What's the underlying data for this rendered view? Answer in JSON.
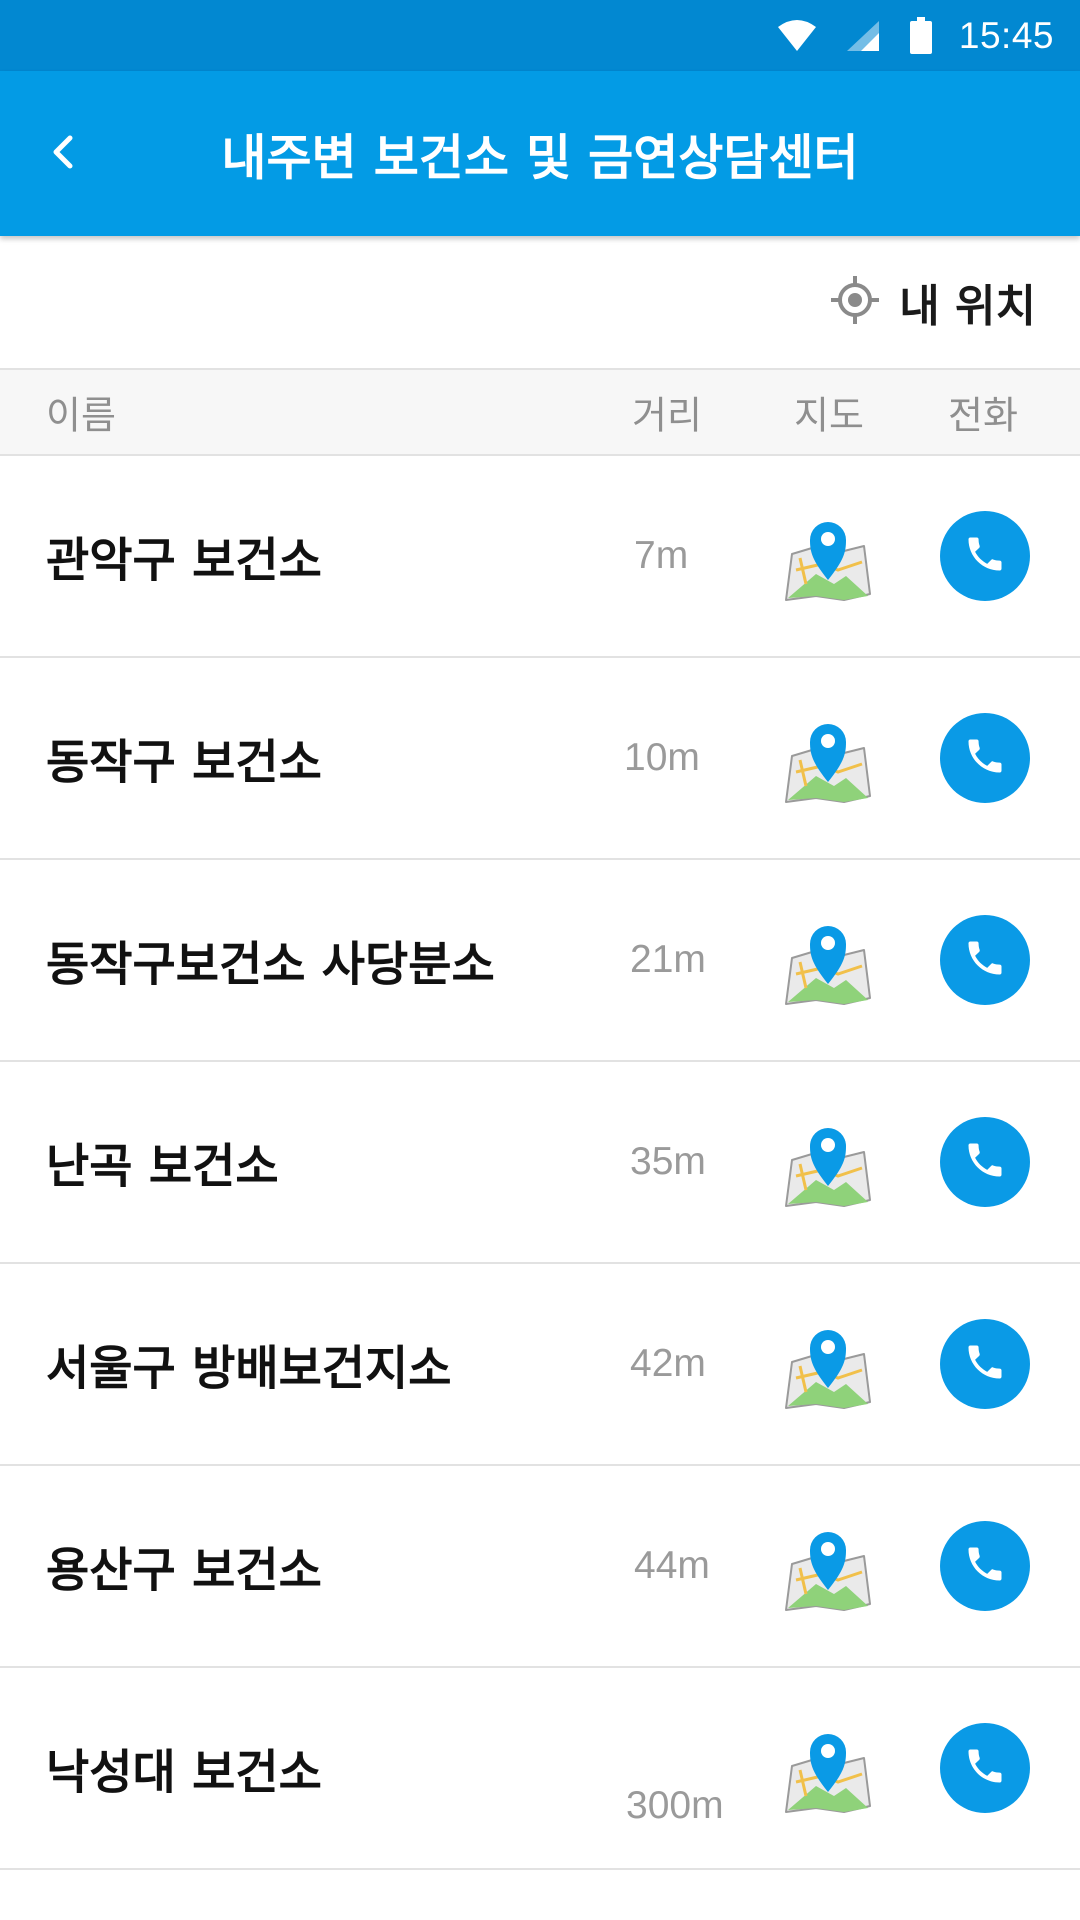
{
  "status_bar": {
    "time": "15:45",
    "icons": [
      "wifi-icon",
      "cell-signal-icon",
      "battery-icon"
    ]
  },
  "app_bar": {
    "back_icon": "chevron-left-icon",
    "title": "내주변 보건소 및 금연상담센터"
  },
  "location": {
    "icon": "crosshair-icon",
    "label": "내 위치"
  },
  "table_header": {
    "name": "이름",
    "distance": "거리",
    "map": "지도",
    "phone": "전화"
  },
  "rows": [
    {
      "name": "관악구 보건소",
      "distance": "7m"
    },
    {
      "name": "동작구 보건소",
      "distance": "10m"
    },
    {
      "name": "동작구보건소 사당분소",
      "distance": "21m"
    },
    {
      "name": "난곡 보건소",
      "distance": "35m"
    },
    {
      "name": "서울구 방배보건지소",
      "distance": "42m"
    },
    {
      "name": "용산구 보건소",
      "distance": "44m"
    },
    {
      "name": "낙성대 보건소",
      "distance": "300m"
    }
  ],
  "colors": {
    "status_bar": "#0288d1",
    "app_bar": "#039be5",
    "accent": "#0a9ae6",
    "map_land": "#8fd27a"
  }
}
